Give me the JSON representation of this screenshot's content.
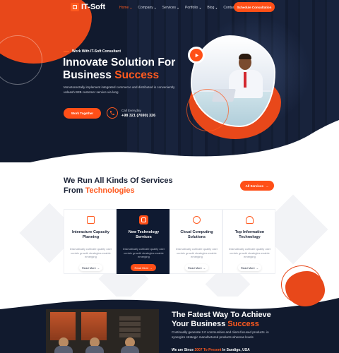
{
  "brand": {
    "name": "IT-Soft",
    "accent": "#ff5a1f",
    "dark": "#111a2e"
  },
  "nav": {
    "items": [
      {
        "label": "Home",
        "dropdown": true,
        "active": true
      },
      {
        "label": "Company",
        "dropdown": true
      },
      {
        "label": "Services",
        "dropdown": true
      },
      {
        "label": "Portfolio",
        "dropdown": true
      },
      {
        "label": "Blog",
        "dropdown": true
      },
      {
        "label": "Contact",
        "dropdown": false
      }
    ],
    "cta": "Schedule Consultation"
  },
  "hero": {
    "kicker": "Work With IT-Soft Consultant",
    "title_line1": "Innovate Solution For",
    "title_line2_plain": "Business ",
    "title_line2_accent": "Success",
    "description": "Monotonectally implement integrated commerce and distributed is conveniently unleash B2B customer service via long",
    "button": "Work Together",
    "call_label": "Call Everyday",
    "call_number": "+98 321 (7690) 326",
    "play_icon": "play-icon"
  },
  "services": {
    "title_line1": "We Run All Kinds Of Services",
    "title_line2_plain": "From ",
    "title_line2_accent": "Technologies",
    "button": "All Services",
    "cards": [
      {
        "title": "Interacture Capacity Planning",
        "description": "Dramatically cultivate quality user centric growth strategies enable emerging",
        "button": "Read More",
        "icon": "monitor-icon",
        "highlighted": false
      },
      {
        "title": "New Technology Services",
        "description": "Dramatically cultivate quality user centric growth strategies enable emerging",
        "button": "Read More",
        "icon": "server-icon",
        "highlighted": true
      },
      {
        "title": "Cloud Computing Solutions",
        "description": "Dramatically cultivate quality user centric growth strategies enable emerging",
        "button": "Read More",
        "icon": "cloud-network-icon",
        "highlighted": false
      },
      {
        "title": "Top Information Technology",
        "description": "Dramatically cultivate quality user centric growth strategies enable emerging",
        "button": "Read More",
        "icon": "lightbulb-icon",
        "highlighted": false
      }
    ]
  },
  "about": {
    "title_line1": "The Fatest Way To Achieve",
    "title_line2_plain": "Your Business ",
    "title_line2_accent": "Success",
    "description": "Continually generate 2.0 communities and client-focused products. in synergize strategic manufactured products whereas levels",
    "since_plain": "We are Since ",
    "since_accent": "2007 To Present",
    "since_suffix": " In Sandigo, USA"
  }
}
